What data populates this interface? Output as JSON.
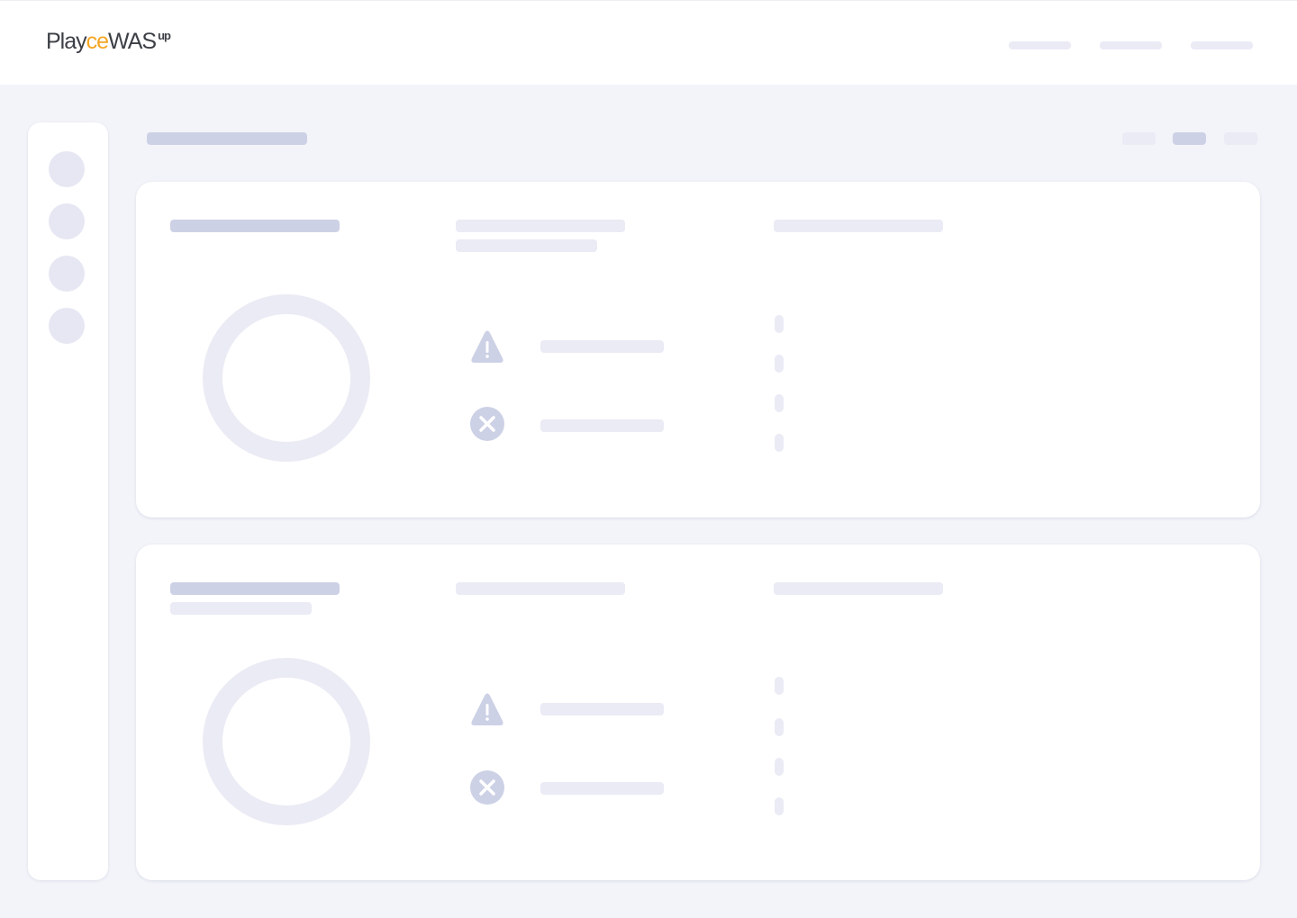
{
  "header": {
    "logo": {
      "part1": "Play",
      "part2": "ce",
      "part3": "WAS",
      "sup": "up"
    }
  },
  "colors": {
    "skeleton_dark": "#cdd1e6",
    "skeleton_light": "#eaebf5",
    "background": "#f3f4f9",
    "logo_accent": "#f5a623"
  },
  "cards": [
    {
      "icons": [
        "warning-icon",
        "error-icon"
      ]
    },
    {
      "icons": [
        "warning-icon",
        "error-icon"
      ]
    }
  ]
}
